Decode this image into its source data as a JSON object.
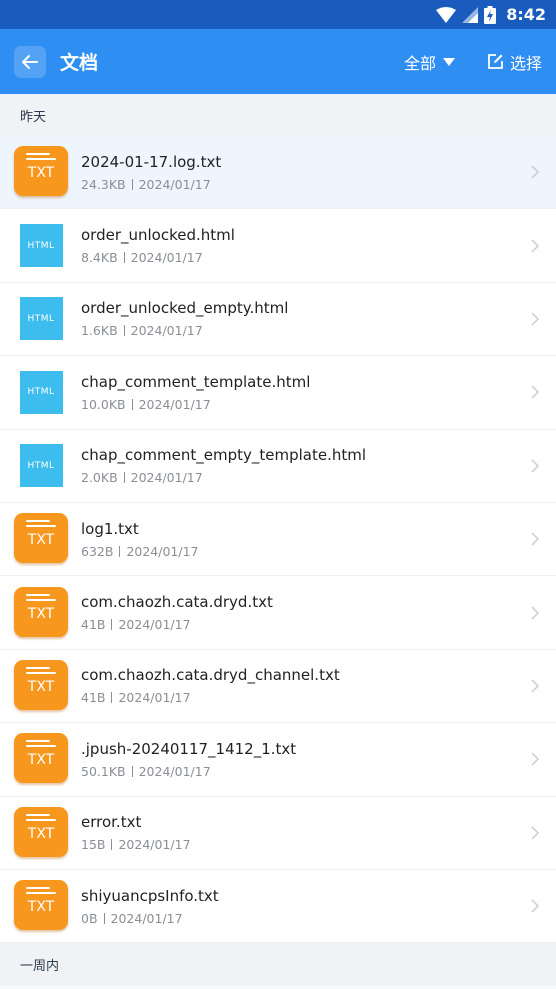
{
  "status_bar": {
    "time": "8:42"
  },
  "app_bar": {
    "title": "文档",
    "filter_label": "全部",
    "select_label": "选择"
  },
  "sections": [
    {
      "header": "昨天"
    },
    {
      "header": "一周内"
    }
  ],
  "files": [
    {
      "name": "2024-01-17.log.txt",
      "size": "24.3KB",
      "date": "2024/01/17",
      "type_label": "TXT"
    },
    {
      "name": "order_unlocked.html",
      "size": "8.4KB",
      "date": "2024/01/17",
      "type_label": "HTML"
    },
    {
      "name": "order_unlocked_empty.html",
      "size": "1.6KB",
      "date": "2024/01/17",
      "type_label": "HTML"
    },
    {
      "name": "chap_comment_template.html",
      "size": "10.0KB",
      "date": "2024/01/17",
      "type_label": "HTML"
    },
    {
      "name": "chap_comment_empty_template.html",
      "size": "2.0KB",
      "date": "2024/01/17",
      "type_label": "HTML"
    },
    {
      "name": "log1.txt",
      "size": "632B",
      "date": "2024/01/17",
      "type_label": "TXT"
    },
    {
      "name": "com.chaozh.cata.dryd.txt",
      "size": "41B",
      "date": "2024/01/17",
      "type_label": "TXT"
    },
    {
      "name": "com.chaozh.cata.dryd_channel.txt",
      "size": "41B",
      "date": "2024/01/17",
      "type_label": "TXT"
    },
    {
      "name": ".jpush-20240117_1412_1.txt",
      "size": "50.1KB",
      "date": "2024/01/17",
      "type_label": "TXT"
    },
    {
      "name": "error.txt",
      "size": "15B",
      "date": "2024/01/17",
      "type_label": "TXT"
    },
    {
      "name": "shiyuancpsInfo.txt",
      "size": "0B",
      "date": "2024/01/17",
      "type_label": "TXT"
    }
  ],
  "colors": {
    "status_bar": "#1a5cbe",
    "app_bar": "#2e8ef2",
    "txt_icon": "#f7971e",
    "html_icon": "#3dbdee"
  }
}
